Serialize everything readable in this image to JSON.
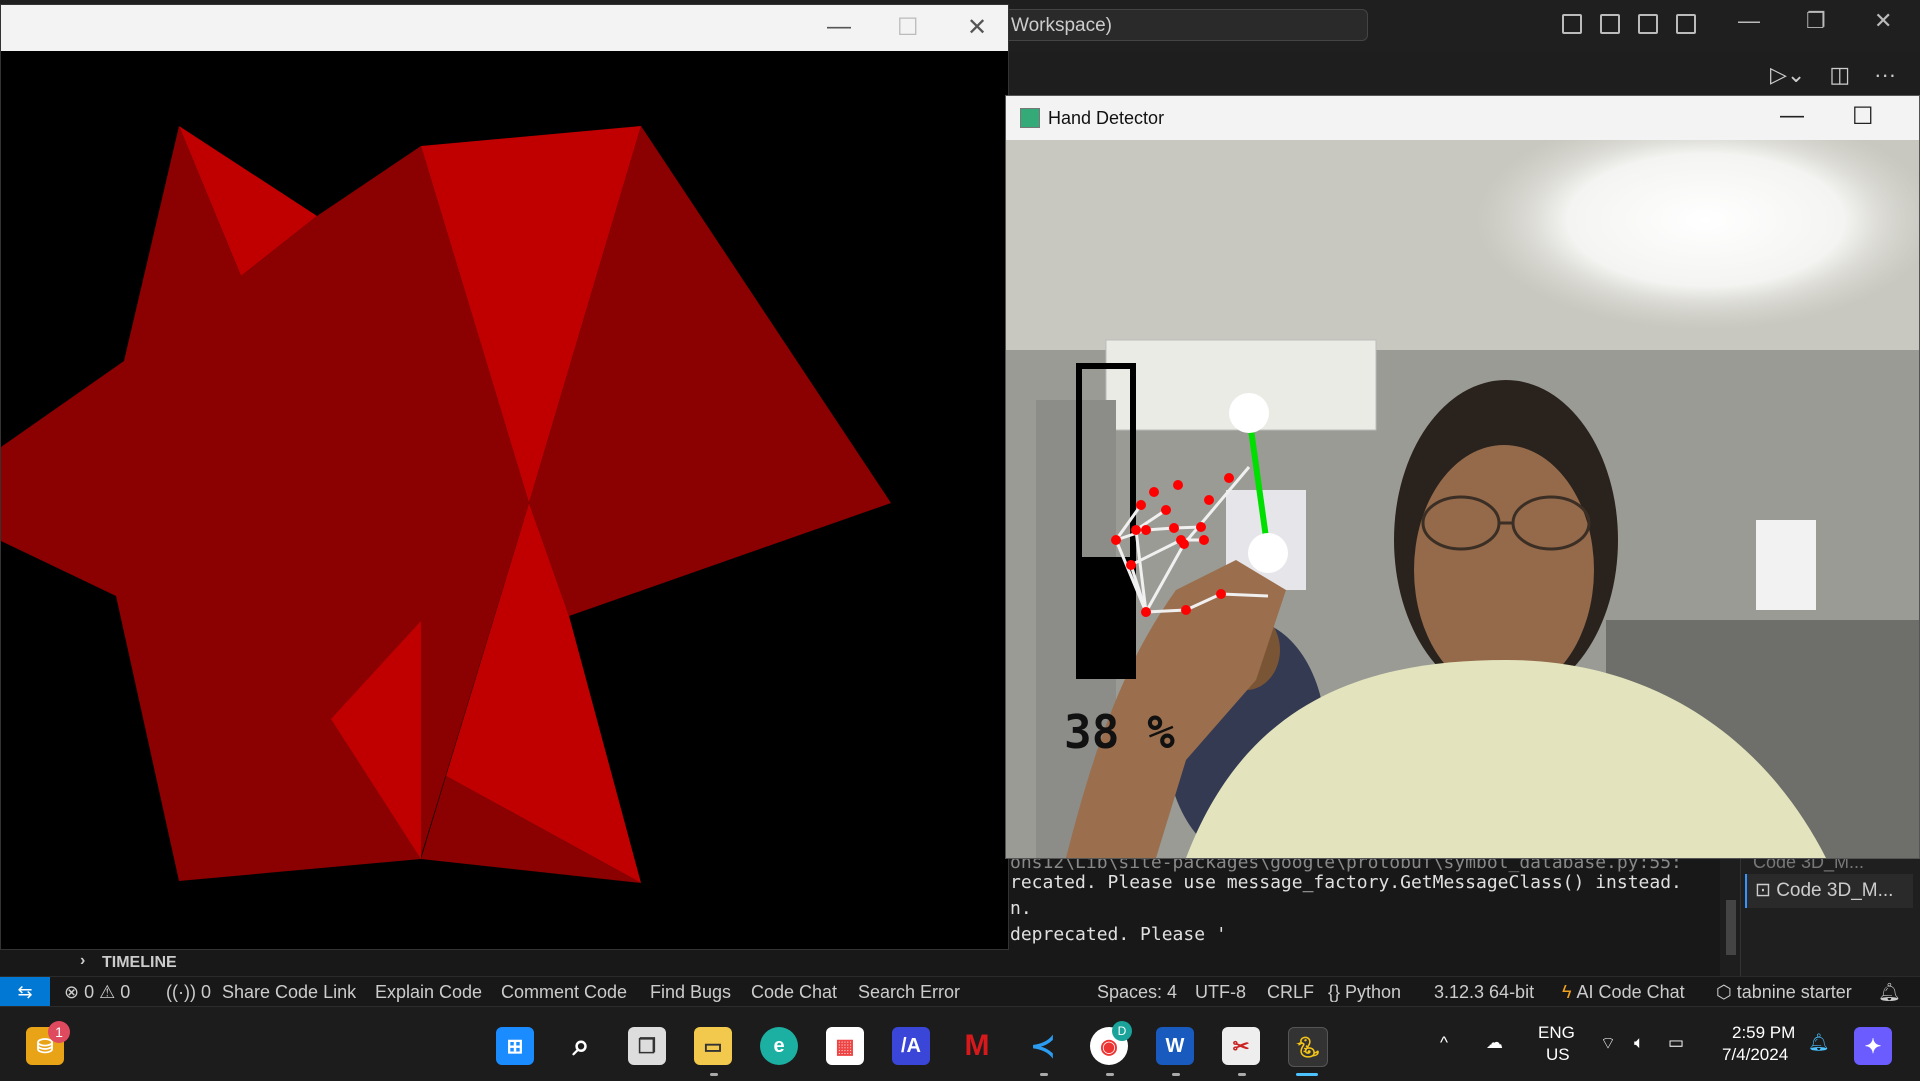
{
  "vscode": {
    "search_text": "Workspace)",
    "timeline_label": "TIMELINE",
    "terminal_lines": [
      "recated. Please use message_factory.GetMessageClass() instead.",
      "n.",
      " deprecated. Please '"
    ],
    "terminal_tab_ghost": "Code 3D_M...",
    "terminal_tab": "Code  3D_M..."
  },
  "statusbar": {
    "errors": "0",
    "warnings": "0",
    "ports": "0",
    "share_code_link": "Share Code Link",
    "explain_code": "Explain Code",
    "comment_code": "Comment Code",
    "find_bugs": "Find Bugs",
    "code_chat": "Code Chat",
    "search_error": "Search Error",
    "spaces": "Spaces: 4",
    "encoding": "UTF-8",
    "eol": "CRLF",
    "language": "Python",
    "interpreter": "3.12.3 64-bit",
    "ai_code_chat": "AI Code Chat",
    "tabnine": "tabnine starter"
  },
  "hand_detector": {
    "title": "Hand Detector",
    "volume_percent_label": "38 %",
    "volume_level": 0.38
  },
  "taskbar": {
    "notification_badge": "1",
    "chrome_badge": "D",
    "lang_line1": "ENG",
    "lang_line2": "US",
    "time": "2:59 PM",
    "date": "7/4/2024"
  },
  "colors": {
    "shape_light": "#c00000",
    "shape_dark": "#8b0000",
    "landmark": "#ff0000",
    "pinch_line": "#00e000",
    "vscode_accent": "#0078d4"
  }
}
